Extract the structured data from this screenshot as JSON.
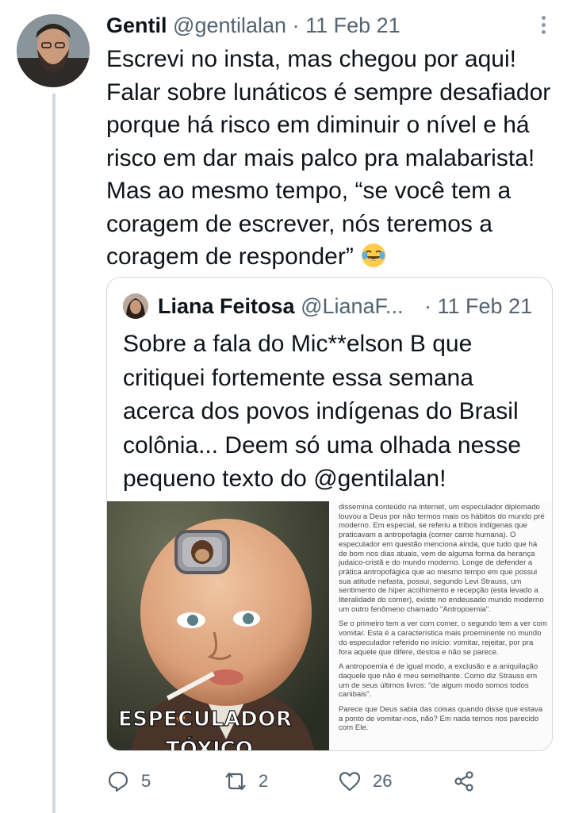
{
  "tweet": {
    "author_name": "Gentil",
    "handle": "@gentilalan",
    "date_sep": "·",
    "date": "11 Feb 21",
    "text_lines": [
      "Escrevi no insta, mas chegou por aqui!",
      "Falar sobre lunáticos é sempre desafiador",
      "porque há risco em diminuir o nível e há",
      "risco em dar mais palco pra malabarista!",
      "Mas ao mesmo tempo, “se você tem a",
      "coragem de escrever, nós teremos a",
      "coragem de responder”"
    ],
    "emoji": "grinning-face-with-tears-emoji"
  },
  "quote": {
    "author_name": "Liana Feitosa",
    "handle": "@LianaF...",
    "date": "· 11 Feb 21",
    "text_lines": [
      "Sobre a fala do Mic**elson B que",
      "critiquei fortemente essa semana",
      "acerca dos povos indígenas do Brasil",
      "colônia... Deem só uma olhada nesse",
      "pequeno texto do @gentilalan!"
    ],
    "image_caption_1": "ESPECULADOR",
    "image_caption_2": "TÓXICO",
    "doc_paragraphs": [
      "dissemina conteúdo na internet, um especulador diplomado louvou a Deus por não termos mais os hábitos do mundo pré moderno. Em especial, se referiu a tribos indígenas que praticavam a antropofagia (comer carne humana). O especulador em questão menciona ainda, que tudo que há de bom nos dias atuais, vem de alguma forma da herança judaico-cristã e do mundo moderno. Longe de defender a prática antropofágica que ao mesmo tempo em que possui sua atitude nefasta, possui, segundo Levi Strauss, um sentimento de hiper acolhimento e recepção (esta levado a literalidade do comer), existe no endeusado mundo moderno um outro fenômeno chamado \"Antropoemia\".",
      "Se o primeiro tem a ver com comer, o segundo tem a ver com vomitar. Esta é a característica mais proeminente no mundo do especulador referido no início: vomitar, rejeitar, por pra fora aquele que difere, destoa e não se parece.",
      "A antropoemia é de igual modo, a exclusão e a aniquilação daquele que não é meu semelhante. Como diz Strauss em um de seus últimos livros: \"de algum modo somos todos canibais\".",
      "Parece que Deus sabia das coisas quando disse que estava a ponto de vomitar-nos, não? Em nada temos nos parecido com Ele."
    ]
  },
  "actions": {
    "reply_count": "5",
    "retweet_count": "2",
    "like_count": "26",
    "share_label": ""
  },
  "icons": [
    "more-options-icon",
    "reply-icon",
    "retweet-icon",
    "like-icon",
    "share-icon"
  ],
  "colors": {
    "text": "#0f1419",
    "muted": "#536471",
    "border": "#cfd9de"
  }
}
